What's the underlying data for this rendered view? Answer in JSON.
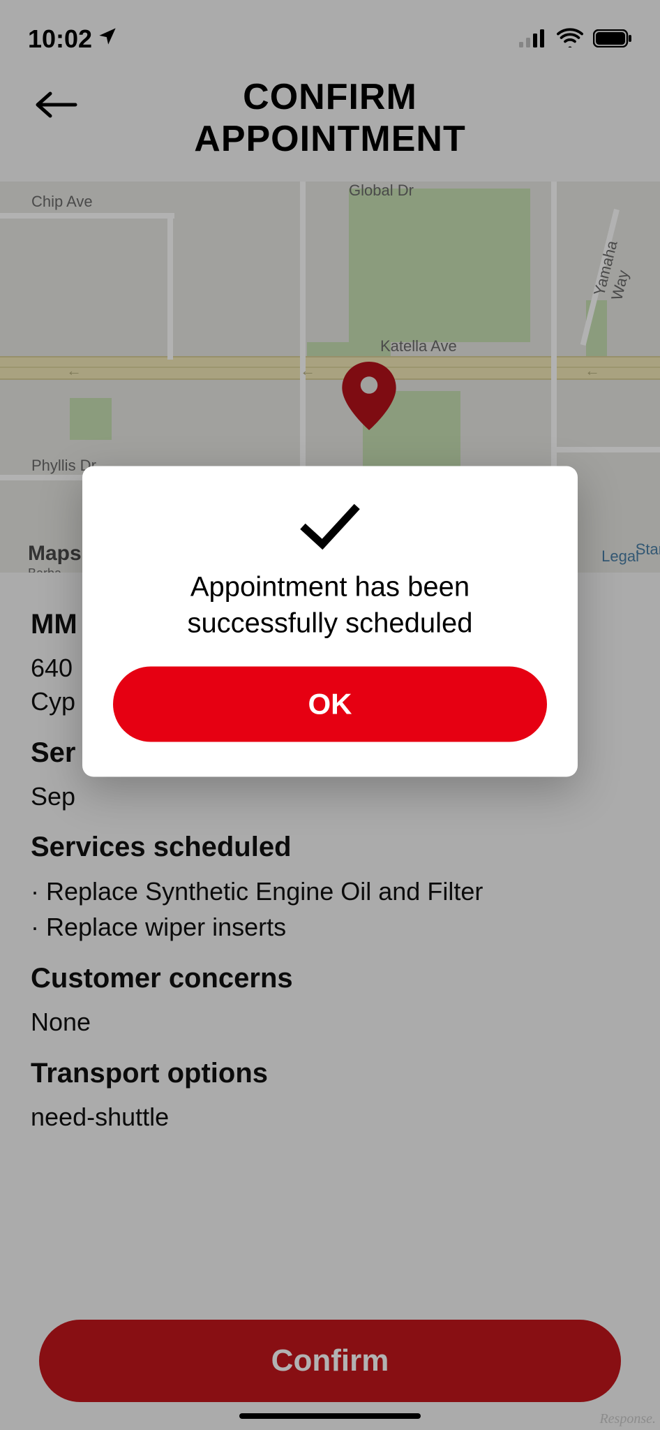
{
  "status": {
    "time": "10:02"
  },
  "header": {
    "title_line1": "CONFIRM",
    "title_line2": "APPOINTMENT"
  },
  "map": {
    "labels": {
      "chip": "Chip Ave",
      "global": "Global Dr",
      "katella": "Katella Ave",
      "phyllis": "Phyllis Dr",
      "yamaha": "Yamaha Way",
      "stan": "Stan"
    },
    "attribution": "Maps",
    "attribution_sub": "Barba",
    "legal": "Legal"
  },
  "details": {
    "dealer_heading": "MM",
    "addr_line1": "640",
    "addr_line2": "Cyp",
    "service_heading": "Ser",
    "service_date": "Sep",
    "services_heading": "Services scheduled",
    "services": [
      "Replace Synthetic Engine Oil and Filter",
      "Replace wiper inserts"
    ],
    "concerns_heading": "Customer concerns",
    "concerns_value": "None",
    "transport_heading": "Transport options",
    "transport_value": "need-shuttle"
  },
  "buttons": {
    "confirm": "Confirm",
    "ok": "OK"
  },
  "modal": {
    "message_l1": "Appointment has been",
    "message_l2": "successfully scheduled"
  },
  "watermark": "Response."
}
